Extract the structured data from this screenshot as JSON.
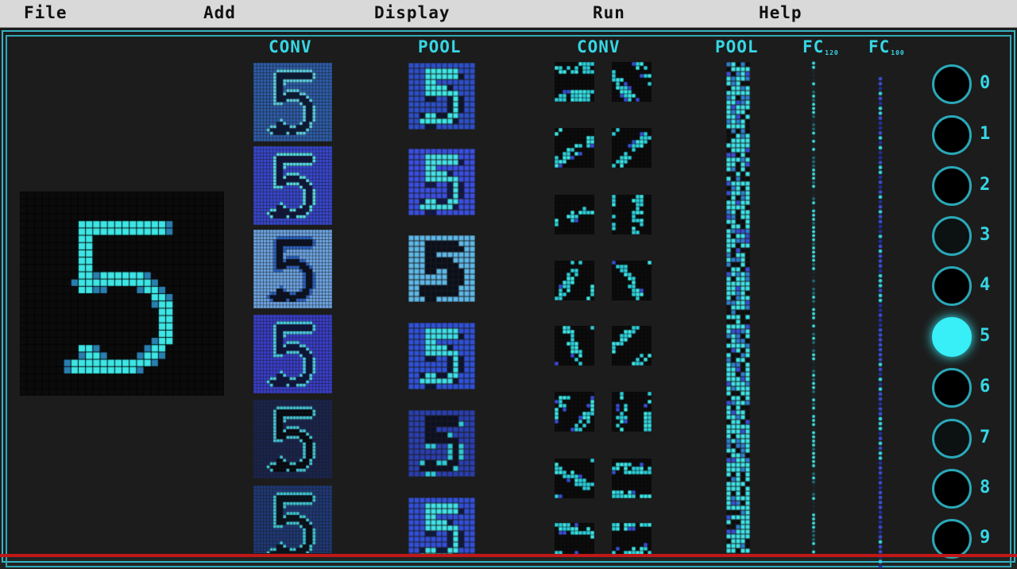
{
  "menu": {
    "file": "File",
    "add": "Add",
    "display": "Display",
    "run": "Run",
    "help": "Help"
  },
  "columns": {
    "conv1": "CONV",
    "pool1": "POOL",
    "conv2": "CONV",
    "pool2": "POOL",
    "fc1": "FC",
    "fc1_sub": "120",
    "fc2": "FC",
    "fc2_sub": "100"
  },
  "input_digit": "5",
  "outputs": {
    "labels": [
      "0",
      "1",
      "2",
      "3",
      "4",
      "5",
      "6",
      "7",
      "8",
      "9"
    ],
    "activations": [
      0.0,
      0.0,
      0.0,
      0.08,
      0.02,
      1.0,
      0.0,
      0.05,
      0.0,
      0.0
    ],
    "predicted": "5"
  },
  "colors": {
    "accent": "#36d6e4",
    "frame": "#2fa8b8",
    "menubar": "#d9d9d9",
    "active_output": "#38eef7",
    "blue": "#3a4fd8"
  }
}
